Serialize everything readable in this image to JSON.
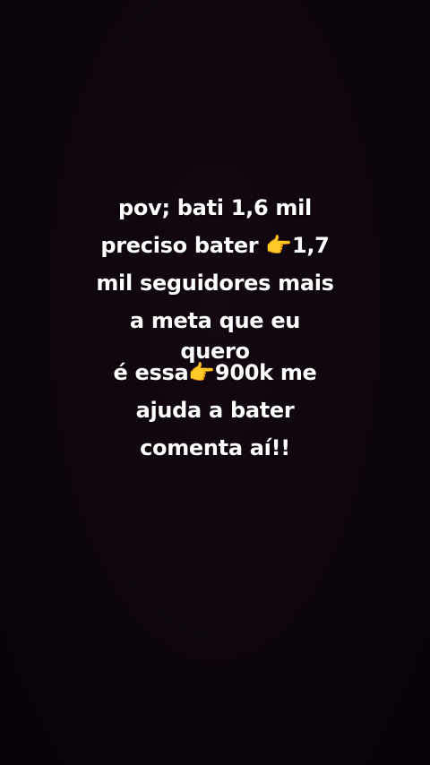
{
  "background_color": "#0d050d",
  "text_color": "#ffffff",
  "caption_top": {
    "lines": [
      "pov; bati 1,6 mil",
      "preciso bater 👉1,7",
      "mil seguidores mais",
      "a meta que eu",
      "quero"
    ]
  },
  "caption_bottom": {
    "lines": [
      "é essa👉900k me",
      "ajuda a bater",
      "comenta aí!!"
    ]
  }
}
